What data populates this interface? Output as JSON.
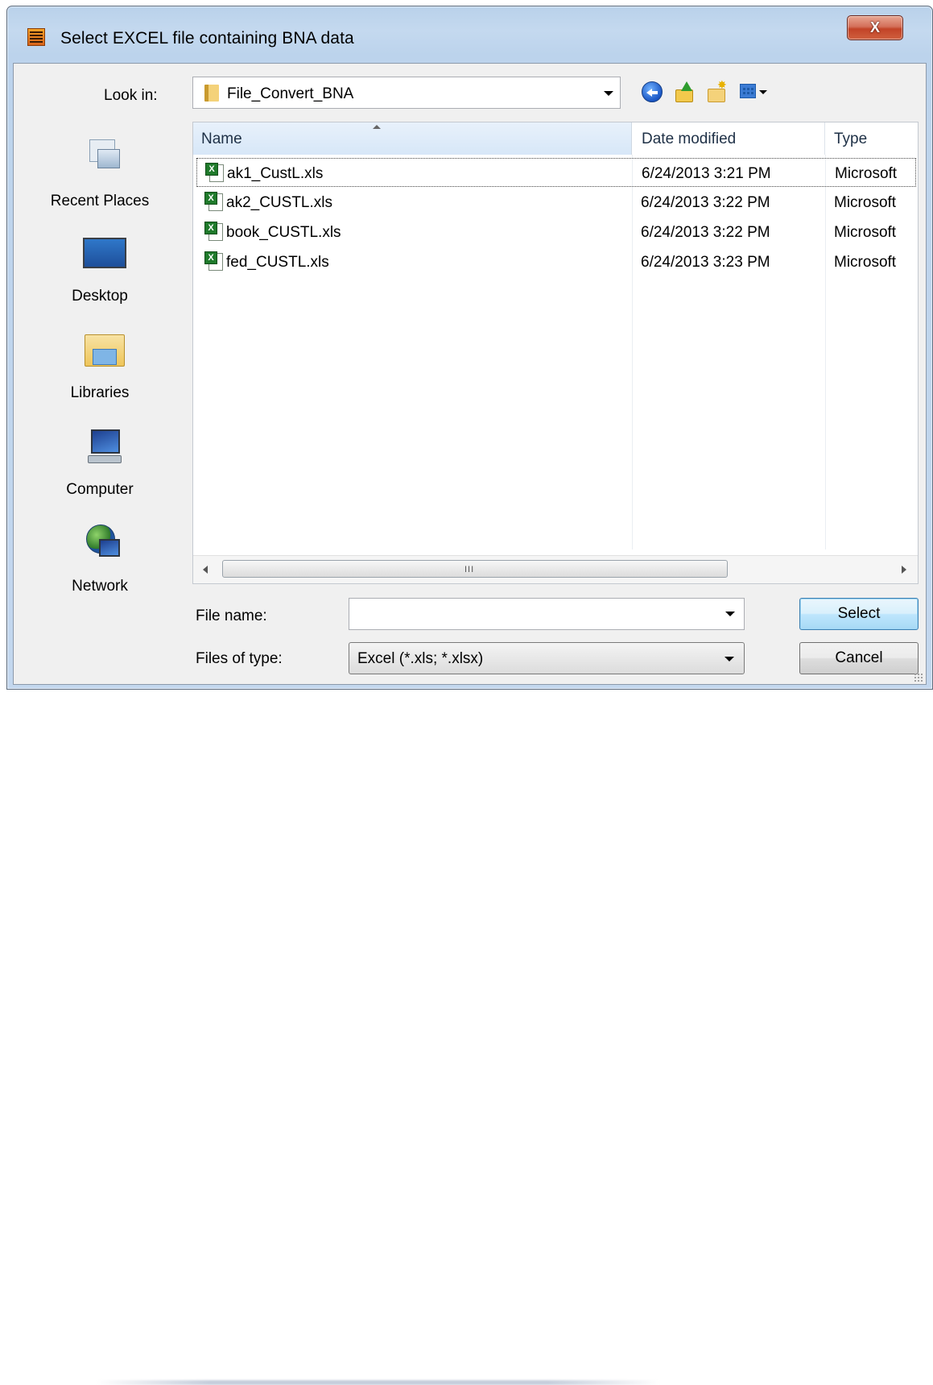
{
  "window": {
    "title": "Select EXCEL file containing BNA data",
    "close_label": "X",
    "app_icon": "asset-keeper-app-icon"
  },
  "lookin": {
    "label": "Look in:",
    "value": "File_Convert_BNA",
    "folder_icon": "folder-icon"
  },
  "toolbar": {
    "back_icon": "back-arrow-icon",
    "up_icon": "up-folder-icon",
    "new_folder_icon": "new-folder-icon",
    "views_icon": "views-menu-icon"
  },
  "places": [
    {
      "label": "Recent Places",
      "icon": "recent-places-icon"
    },
    {
      "label": "Desktop",
      "icon": "desktop-icon"
    },
    {
      "label": "Libraries",
      "icon": "libraries-icon"
    },
    {
      "label": "Computer",
      "icon": "computer-icon"
    },
    {
      "label": "Network",
      "icon": "network-icon"
    }
  ],
  "filelist": {
    "columns": [
      "Name",
      "Date modified",
      "Type"
    ],
    "sorted_column": "Name",
    "rows": [
      {
        "name": "ak1_CustL.xls",
        "date": "6/24/2013 3:21 PM",
        "type": "Microsoft",
        "focused": true
      },
      {
        "name": "ak2_CUSTL.xls",
        "date": "6/24/2013 3:22 PM",
        "type": "Microsoft"
      },
      {
        "name": "book_CUSTL.xls",
        "date": "6/24/2013 3:22 PM",
        "type": "Microsoft"
      },
      {
        "name": "fed_CUSTL.xls",
        "date": "6/24/2013 3:23 PM",
        "type": "Microsoft"
      }
    ],
    "scroll_grip": "III"
  },
  "filename": {
    "label": "File name:",
    "value": ""
  },
  "filetype": {
    "label": "Files of type:",
    "value": "Excel (*.xls; *.xlsx)"
  },
  "buttons": {
    "select": "Select",
    "cancel": "Cancel"
  },
  "colors": {
    "frame": "#c3d7ee",
    "client": "#f0f0f0",
    "header_highlight": "#d7e7f8",
    "default_button": "#bee6fd",
    "close_button": "#c24327"
  }
}
